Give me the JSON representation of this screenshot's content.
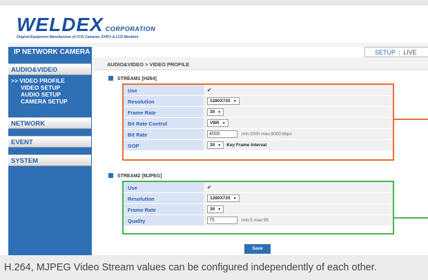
{
  "brand": {
    "logo_main": "WELDEX",
    "logo_corp": "CORPORATION",
    "tagline": "Original Equipment Manufacturer of CCD Cameras, DVR's & LCD Monitors"
  },
  "sidebar": {
    "title": "IP NETWORK CAMERA",
    "categories": [
      "AUDIO&VIDEO",
      "NETWORK",
      "EVENT",
      "SYSTEM"
    ],
    "subitems": [
      {
        "label": ">> VIDEO PROFILE",
        "active": true
      },
      {
        "label": "VIDEO SETUP",
        "active": false
      },
      {
        "label": "AUDIO SETUP",
        "active": false
      },
      {
        "label": "CAMERA SETUP",
        "active": false
      }
    ]
  },
  "tabs": {
    "setup": "SETUP",
    "separator": "|",
    "live": "LIVE"
  },
  "breadcrumb": "AUDIO&VIDEO > VIDEO PROFILE",
  "stream1": {
    "title": "STREAM1 [H264]",
    "rows": {
      "use_label": "Use",
      "resolution_label": "Resolution",
      "resolution_value": "1280X720",
      "framerate_label": "Frame Rate",
      "framerate_value": "30",
      "bitrate_control_label": "Bit Rate Control",
      "bitrate_control_value": "VBR",
      "bitrate_label": "Bit Rate",
      "bitrate_value": "4000",
      "bitrate_hint": "min:2000 max:8000 kbps",
      "gop_label": "GOP",
      "gop_value": "30",
      "gop_hint": "Key Frame Interval"
    }
  },
  "stream2": {
    "title": "STREAM2 [MJPEG]",
    "rows": {
      "use_label": "Use",
      "resolution_label": "Resolution",
      "resolution_value": "1280X720",
      "framerate_label": "Frame Rate",
      "framerate_value": "30",
      "quality_label": "Quality",
      "quality_value": "75",
      "quality_hint": "min:5 max:95"
    }
  },
  "save_label": "Save",
  "caption": "H.264, MJPEG Video Stream values can be configured independently of each other.",
  "colors": {
    "brand_blue": "#1a4fa0",
    "sidebar_blue": "#2f6fb5",
    "stream1_highlight": "#e86a36",
    "stream2_highlight": "#42b54a"
  }
}
